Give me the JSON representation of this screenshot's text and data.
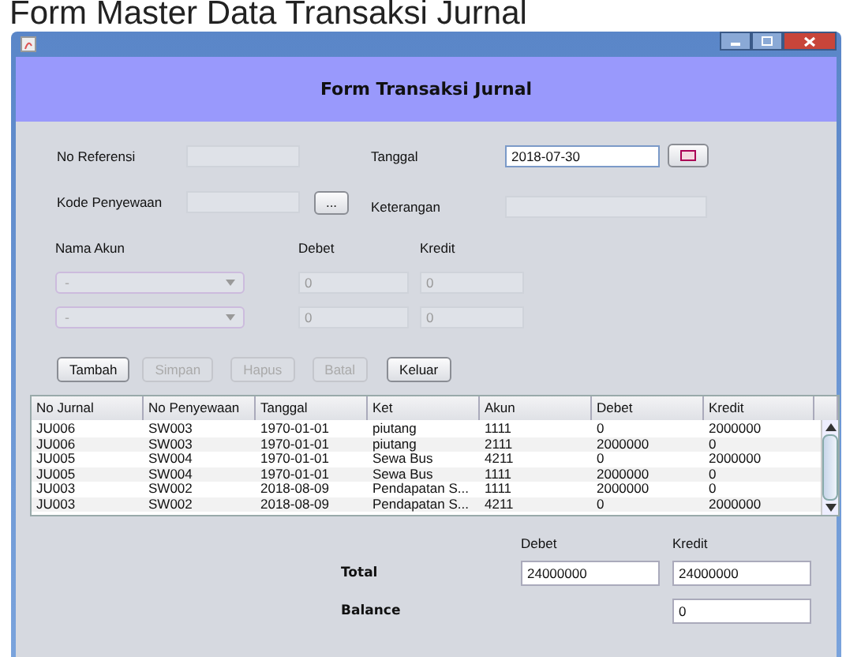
{
  "caption": "Form Master Data Transaksi Jurnal",
  "window": {
    "title": "Form Transaksi Jurnal"
  },
  "form": {
    "fields": [
      {
        "label": "No Referensi",
        "disabled": true
      },
      {
        "label": "Tanggal",
        "value": "2018-07-30",
        "disabled": false
      },
      {
        "label": "Kode Penyewaan",
        "disabled": true
      },
      {
        "label": "Keterangan",
        "disabled": true
      }
    ],
    "entry_columns": [
      "Nama Akun",
      "Debet",
      "Kredit"
    ],
    "entries": [
      {
        "account": "-",
        "debet": "0",
        "kredit": "0",
        "disabled": true
      },
      {
        "account": "-",
        "debet": "0",
        "kredit": "0",
        "disabled": true
      }
    ],
    "browse_button": "..."
  },
  "buttons": [
    {
      "label": "Tambah",
      "disabled": false
    },
    {
      "label": "Simpan",
      "disabled": true
    },
    {
      "label": "Hapus",
      "disabled": true
    },
    {
      "label": "Batal",
      "disabled": true
    },
    {
      "label": "Keluar",
      "disabled": false
    }
  ],
  "table": {
    "columns": [
      "No Jurnal",
      "No Penyewaan",
      "Tanggal",
      "Ket",
      "Akun",
      "Debet",
      "Kredit"
    ],
    "rows": [
      [
        "JU006",
        "SW003",
        "1970-01-01",
        "piutang",
        "1111",
        "0",
        "2000000"
      ],
      [
        "JU006",
        "SW003",
        "1970-01-01",
        "piutang",
        "2111",
        "2000000",
        "0"
      ],
      [
        "JU005",
        "SW004",
        "1970-01-01",
        "Sewa Bus",
        "4211",
        "0",
        "2000000"
      ],
      [
        "JU005",
        "SW004",
        "1970-01-01",
        "Sewa Bus",
        "1111",
        "2000000",
        "0"
      ],
      [
        "JU003",
        "SW002",
        "2018-08-09",
        "Pendapatan S...",
        "1111",
        "2000000",
        "0"
      ],
      [
        "JU003",
        "SW002",
        "2018-08-09",
        "Pendapatan S...",
        "4211",
        "0",
        "2000000"
      ]
    ]
  },
  "totals": {
    "column_labels": [
      "Debet",
      "Kredit"
    ],
    "total_label": "Total",
    "total_debet": "24000000",
    "total_kredit": "24000000",
    "balance_label": "Balance",
    "balance": "0"
  }
}
